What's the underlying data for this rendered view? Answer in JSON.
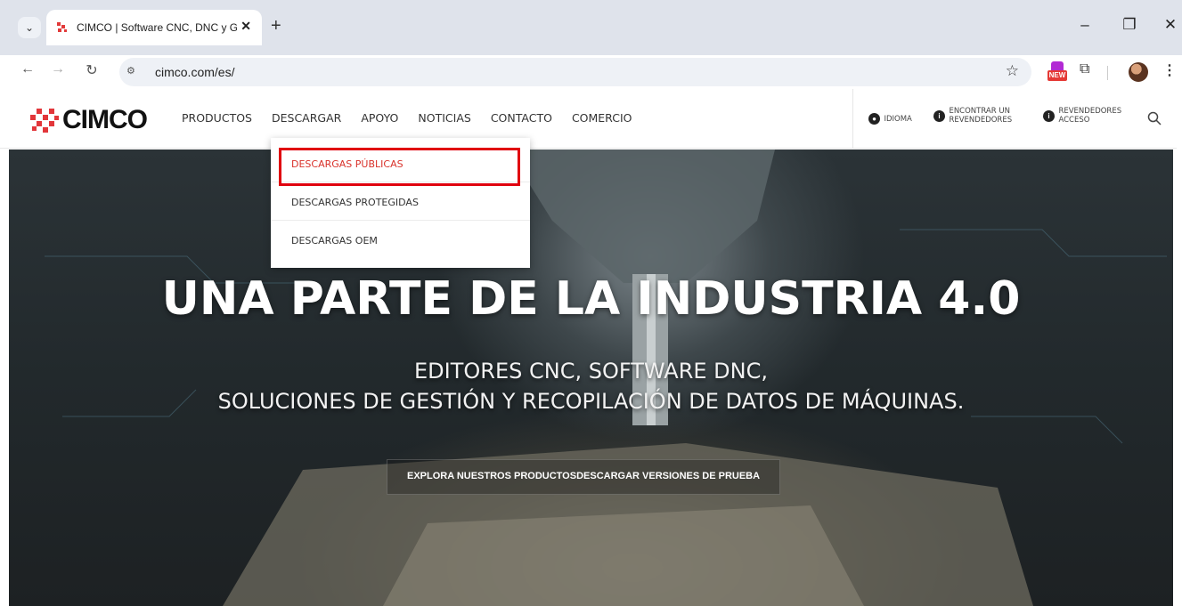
{
  "browser": {
    "tab": {
      "title": "CIMCO | Software CNC, DNC y G"
    },
    "address": {
      "url": "cimco.com/es/"
    },
    "extension_badge": "NEW"
  },
  "site": {
    "logo_text": "CIMCO",
    "nav": [
      "PRODUCTOS",
      "DESCARGAR",
      "APOYO",
      "NOTICIAS",
      "CONTACTO",
      "COMERCIO"
    ],
    "header_right": {
      "language": "IDIOMA",
      "find_resellers": [
        "ENCONTRAR UN",
        "REVENDEDORES"
      ],
      "resellers_access": [
        "REVENDEDORES",
        "ACCESO"
      ]
    },
    "dropdown": [
      "DESCARGAS PÚBLICAS",
      "DESCARGAS PROTEGIDAS",
      "DESCARGAS OEM"
    ],
    "hero": {
      "title": "UNA PARTE DE LA INDUSTRIA 4.0",
      "subtitle_line1": "EDITORES CNC, SOFTWARE DNC,",
      "subtitle_line2": "SOLUCIONES DE GESTIÓN Y RECOPILACIÓN DE DATOS DE MÁQUINAS.",
      "cta_products": "EXPLORA NUESTROS PRODUCTOS",
      "cta_trial": "DESCARGAR VERSIONES DE PRUEBA"
    }
  },
  "colors": {
    "brand_red": "#d9322b",
    "highlight": "#e0000f"
  }
}
